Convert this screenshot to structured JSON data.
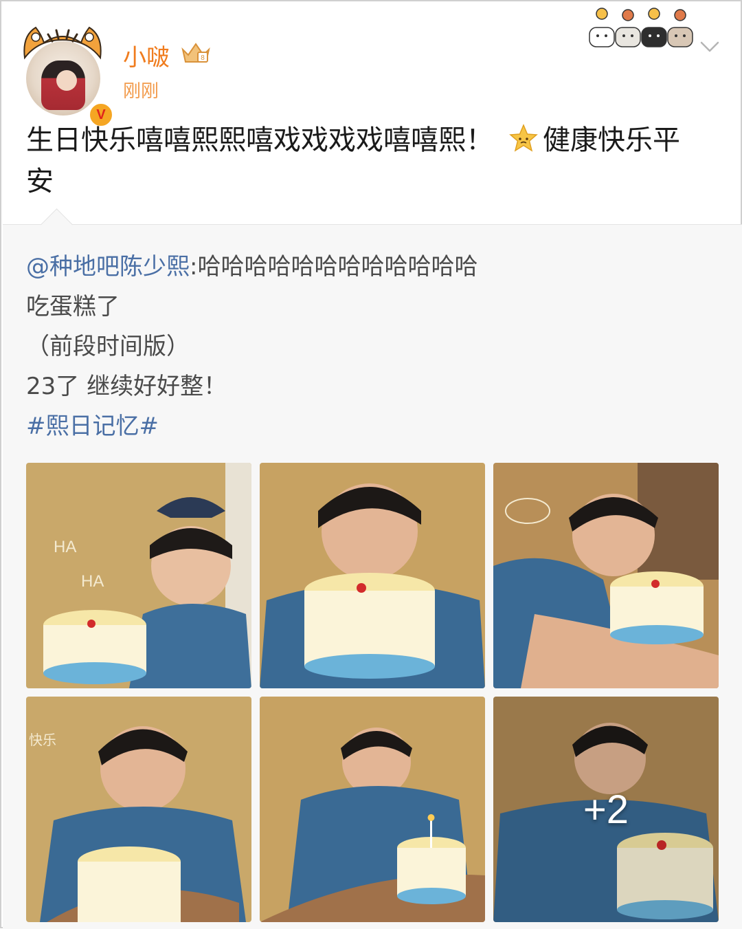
{
  "user": {
    "name": "小啵",
    "time": "刚刚",
    "verified_icon": "verified-badge-icon"
  },
  "post": {
    "text_part1": "生日快乐嘻嘻熙熙嘻戏戏戏戏嘻嘻熙！",
    "text_part2": "健康快乐平",
    "text_part3": "安"
  },
  "repost": {
    "mention": "@种地吧陈少熙",
    "line1_rest": ":哈哈哈哈哈哈哈哈哈哈哈哈",
    "line2": "吃蛋糕了",
    "line3": "（前段时间版）",
    "line4": "23了 继续好好整！",
    "hashtag": "#熙日记忆#"
  },
  "gallery": {
    "more_count": "+2"
  },
  "colors": {
    "username": "#f07c1e",
    "timestamp": "#f29a4a",
    "link": "#4a6fa5",
    "repost_bg": "#f7f7f7"
  }
}
